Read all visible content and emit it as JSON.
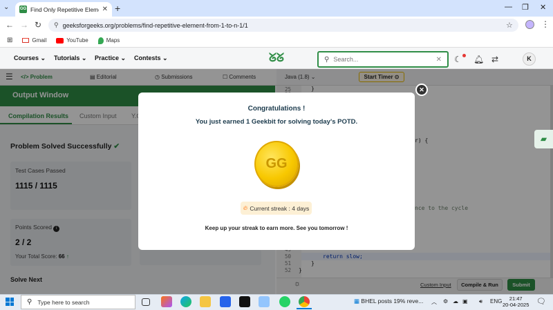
{
  "browser": {
    "tab_title": "Find Only Repetitive Element fr",
    "url": "geeksforgeeks.org/problems/find-repetitive-element-from-1-to-n-1/1",
    "bookmarks": [
      "Gmail",
      "YouTube",
      "Maps"
    ]
  },
  "gfg_nav": {
    "items": [
      "Courses",
      "Tutorials",
      "Practice",
      "Contests"
    ],
    "search_placeholder": "Search...",
    "avatar_letter": "K"
  },
  "problem_tabs": [
    "Problem",
    "Editorial",
    "Submissions",
    "Comments"
  ],
  "editor": {
    "language": "Java (1.8)",
    "timer_label": "Start Timer",
    "line_numbers": [
      "25",
      "26",
      "49",
      "50",
      "51",
      "52"
    ],
    "code_fragments": {
      "top": "}",
      "mid1": "r) {",
      "mid2": "nce to the cycle",
      "line50": "return slow;",
      "line51": "}",
      "line52": "}"
    },
    "custom_input": "Custom Input",
    "compile_run": "Compile & Run",
    "submit": "Submit"
  },
  "output": {
    "title": "Output Window",
    "tabs": [
      "Compilation Results",
      "Custom Input",
      "Y.O"
    ],
    "status": "Problem Solved Successfully",
    "test_cases_label": "Test Cases Passed",
    "test_cases_value": "1115 / 1115",
    "points_label": "Points Scored",
    "points_value": "2 / 2",
    "total_score_label": "Your Total Score:",
    "total_score_value": "66",
    "solve_next": "Solve Next"
  },
  "modal": {
    "heading": "Congratulations !",
    "message": "You just earned 1 Geekbit for solving today's POTD.",
    "coin_logo": "GG",
    "streak": "Current streak : 4 days",
    "footer": "Keep up your streak to earn more. See you tomorrow !"
  },
  "taskbar": {
    "search_placeholder": "Type here to search",
    "news": "BHEL posts 19% reve...",
    "lang": "ENG",
    "time": "21:47",
    "date": "20-04-2025"
  },
  "colors": {
    "gfg_green": "#2f8d46",
    "coin_gold": "#f8c800",
    "streak_bg": "#fdf0d5"
  }
}
